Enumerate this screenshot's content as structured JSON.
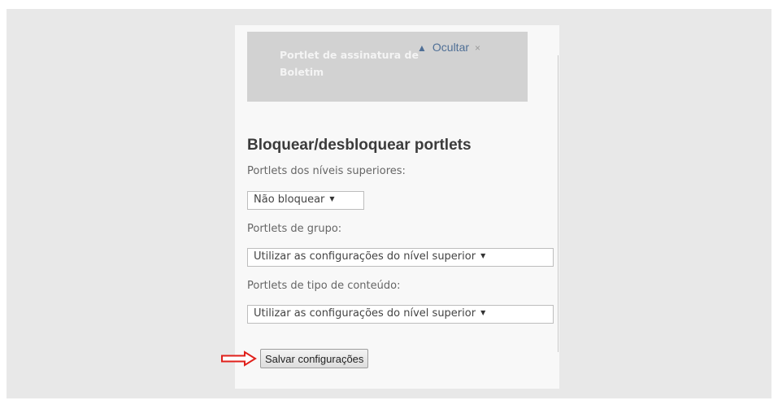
{
  "portlet": {
    "title": "Portlet de assinatura de Boletim",
    "hide_label": "Ocultar",
    "close_glyph": "×",
    "up_glyph": "▲"
  },
  "lock_section": {
    "title": "Bloquear/desbloquear portlets",
    "upper_levels": {
      "label": "Portlets dos níveis superiores:",
      "selected": "Não bloquear"
    },
    "group": {
      "label": "Portlets de grupo:",
      "selected": "Utilizar as configurações do nível superior"
    },
    "content_type": {
      "label": "Portlets de tipo de conteúdo:",
      "selected": "Utilizar as configurações do nível superior"
    },
    "dropdown_glyph": "▼",
    "save_label": "Salvar configurações"
  },
  "colors": {
    "annotation_arrow": "#e0201b",
    "portlet_box": "#d2d2d2",
    "link": "#4f6f96"
  }
}
